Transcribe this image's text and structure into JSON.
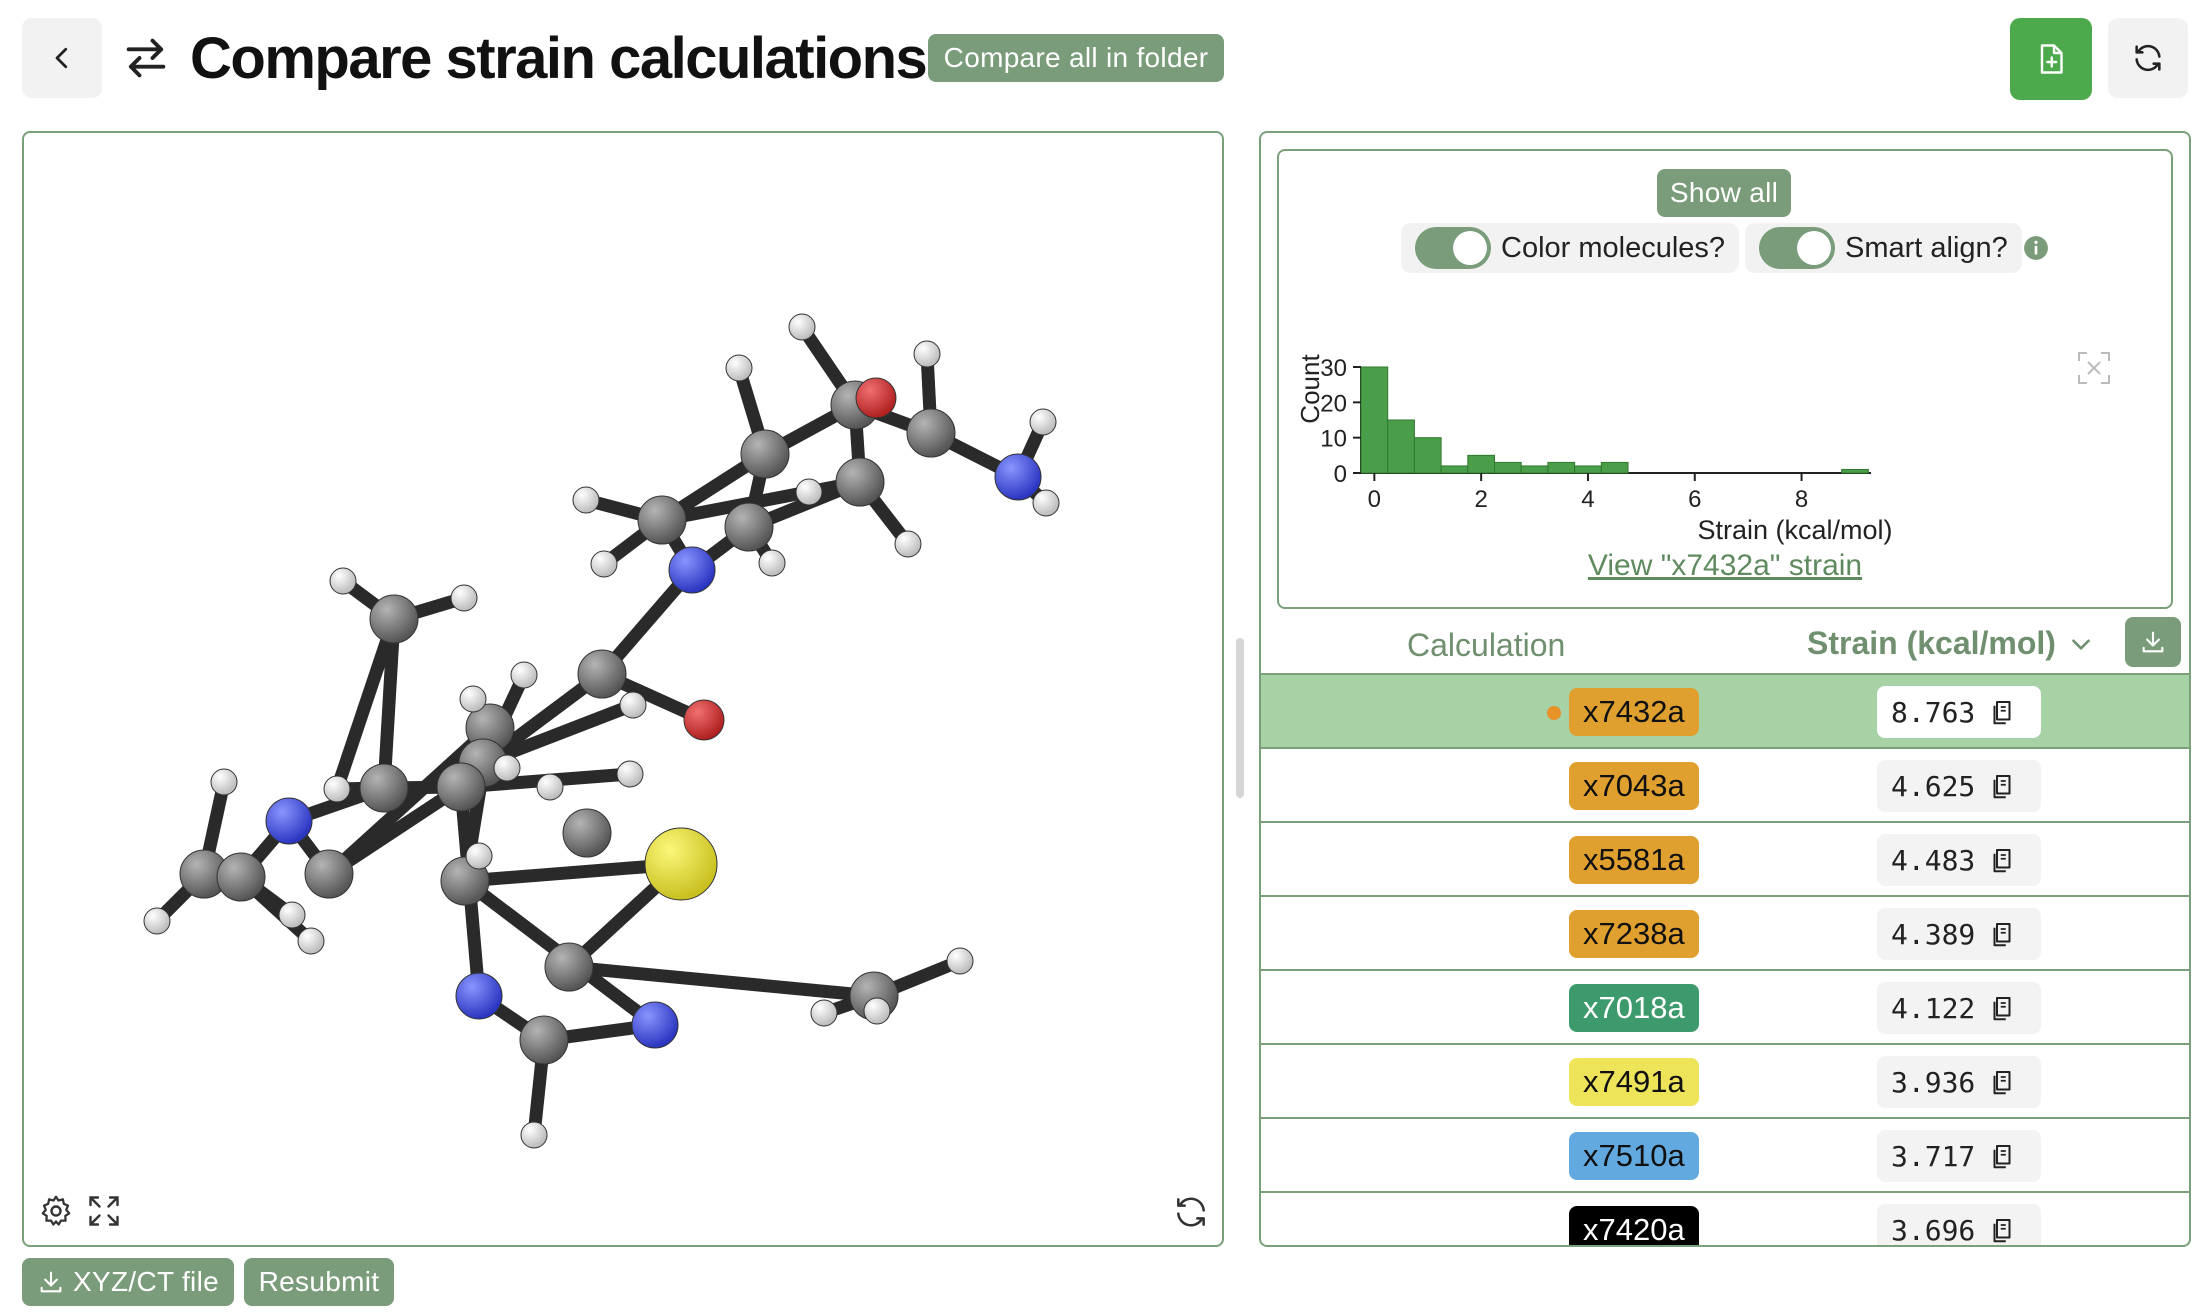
{
  "header": {
    "title": "Compare strain calculations",
    "compare_all_label": "Compare all in folder"
  },
  "viewer": {
    "xyz_button_label": "XYZ/CT file",
    "resubmit_label": "Resubmit"
  },
  "panel": {
    "show_all_label": "Show all",
    "color_molecules_label": "Color molecules?",
    "smart_align_label": "Smart align?",
    "view_link": "View \"x7432a\" strain"
  },
  "chart_data": {
    "type": "bar",
    "xlabel": "Strain (kcal/mol)",
    "ylabel": "Count",
    "xlim": [
      -0.25,
      9.3
    ],
    "ylim": [
      0,
      30
    ],
    "xticks": [
      0,
      2,
      4,
      6,
      8
    ],
    "yticks": [
      0,
      10,
      20,
      30
    ],
    "bin_width": 0.5,
    "bins": [
      {
        "x0": -0.25,
        "count": 30
      },
      {
        "x0": 0.25,
        "count": 15
      },
      {
        "x0": 0.75,
        "count": 10
      },
      {
        "x0": 1.25,
        "count": 2
      },
      {
        "x0": 1.75,
        "count": 5
      },
      {
        "x0": 2.25,
        "count": 3
      },
      {
        "x0": 2.75,
        "count": 2
      },
      {
        "x0": 3.25,
        "count": 3
      },
      {
        "x0": 3.75,
        "count": 2
      },
      {
        "x0": 4.25,
        "count": 3
      },
      {
        "x0": 8.75,
        "count": 1
      }
    ],
    "color": "#4a9e4a"
  },
  "table": {
    "col_calculation": "Calculation",
    "col_strain": "Strain (kcal/mol)",
    "rows": [
      {
        "name": "x7432a",
        "value": "8.763",
        "badge_color": "#e0a030",
        "text_color": "#111111",
        "selected": true
      },
      {
        "name": "x7043a",
        "value": "4.625",
        "badge_color": "#e0a030",
        "text_color": "#111111",
        "selected": false
      },
      {
        "name": "x5581a",
        "value": "4.483",
        "badge_color": "#e0a030",
        "text_color": "#111111",
        "selected": false
      },
      {
        "name": "x7238a",
        "value": "4.389",
        "badge_color": "#e0a030",
        "text_color": "#111111",
        "selected": false
      },
      {
        "name": "x7018a",
        "value": "4.122",
        "badge_color": "#3d9a6c",
        "text_color": "#ffffff",
        "selected": false
      },
      {
        "name": "x7491a",
        "value": "3.936",
        "badge_color": "#eee45a",
        "text_color": "#111111",
        "selected": false
      },
      {
        "name": "x7510a",
        "value": "3.717",
        "badge_color": "#62a9df",
        "text_color": "#111111",
        "selected": false
      },
      {
        "name": "x7420a",
        "value": "3.696",
        "badge_color": "#000000",
        "text_color": "#ffffff",
        "selected": false
      }
    ]
  },
  "colors": {
    "accent": "#7a9c7a",
    "primary_button": "#4caa4c",
    "selected_row": "#a6d2a6",
    "selected_dot": "#e8922a"
  }
}
